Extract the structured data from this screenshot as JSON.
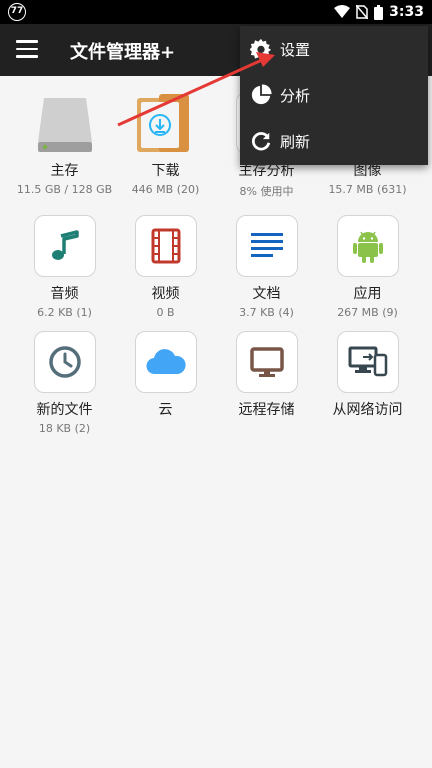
{
  "status_bar": {
    "notification_badge": "77",
    "time": "3:33"
  },
  "app_bar": {
    "title": "文件管理器+"
  },
  "tiles": [
    {
      "name": "主存",
      "sub": "11.5 GB / 128 GB",
      "icon": "hard-drive-icon"
    },
    {
      "name": "下载",
      "sub": "446 MB (20)",
      "icon": "download-folder-icon"
    },
    {
      "name": "主存分析",
      "sub": "8% 使用中",
      "icon": "storage-analysis-icon"
    },
    {
      "name": "图像",
      "sub": "15.7 MB (631)",
      "icon": "image-icon"
    },
    {
      "name": "音频",
      "sub": "6.2 KB (1)",
      "icon": "music-note-icon"
    },
    {
      "name": "视频",
      "sub": "0 B",
      "icon": "film-strip-icon"
    },
    {
      "name": "文档",
      "sub": "3.7 KB (4)",
      "icon": "document-lines-icon"
    },
    {
      "name": "应用",
      "sub": "267 MB (9)",
      "icon": "android-icon"
    },
    {
      "name": "新的文件",
      "sub": "18 KB (2)",
      "icon": "clock-icon"
    },
    {
      "name": "云",
      "sub": "",
      "icon": "cloud-icon"
    },
    {
      "name": "远程存储",
      "sub": "",
      "icon": "monitor-icon"
    },
    {
      "name": "从网络访问",
      "sub": "",
      "icon": "network-devices-icon"
    }
  ],
  "overflow_menu": {
    "items": [
      {
        "label": "设置",
        "icon": "gear-icon"
      },
      {
        "label": "分析",
        "icon": "pie-chart-icon"
      },
      {
        "label": "刷新",
        "icon": "refresh-icon"
      }
    ]
  },
  "colors": {
    "app_bar": "#212121",
    "accent_teal": "#1e7f74",
    "video_red": "#c0392b",
    "document_blue": "#1565c0",
    "android_green": "#8bc34a",
    "clock_slate": "#546e7a",
    "cloud_blue": "#42a5f5",
    "monitor_brown": "#795548",
    "arrow_red": "#e53935"
  }
}
